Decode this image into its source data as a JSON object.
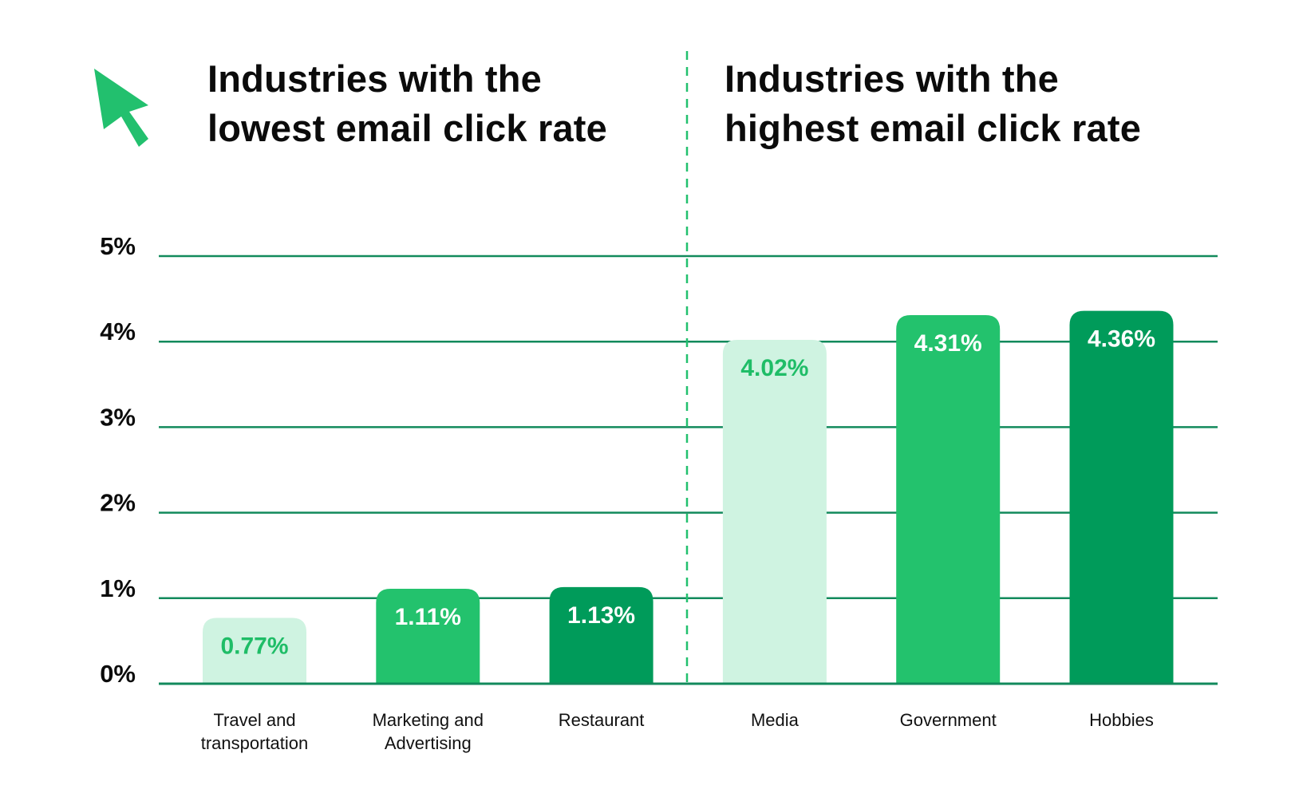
{
  "titles": {
    "left": [
      "Industries with the",
      "lowest email click rate"
    ],
    "right": [
      "Industries with the",
      "highest email click rate"
    ]
  },
  "icons": {
    "cursor": "cursor-arrow-icon"
  },
  "colors": {
    "grid": "#128a5c",
    "divider": "#22c06e",
    "light": "#cff3e1",
    "mid": "#23c26d",
    "dark": "#009b5a",
    "light_label": "#1fbd67",
    "white_label": "#ffffff",
    "cursor": "#22c06e"
  },
  "chart_data": {
    "type": "bar",
    "title": "Industries with the lowest / highest email click rate",
    "xlabel": "",
    "ylabel": "",
    "ylim": [
      0,
      5
    ],
    "yticks": [
      0,
      1,
      2,
      3,
      4,
      5
    ],
    "ytick_labels": [
      "0%",
      "1%",
      "2%",
      "3%",
      "4%",
      "5%"
    ],
    "grid": true,
    "groups": [
      {
        "name": "Industries with the lowest email click rate",
        "categories": [
          0,
          1,
          2
        ]
      },
      {
        "name": "Industries with the highest email click rate",
        "categories": [
          3,
          4,
          5
        ]
      }
    ],
    "categories": [
      "Travel and transportation",
      "Marketing and Advertising",
      "Restaurant",
      "Media",
      "Government",
      "Hobbies"
    ],
    "category_lines": [
      [
        "Travel and",
        "transportation"
      ],
      [
        "Marketing and",
        "Advertising"
      ],
      [
        "Restaurant"
      ],
      [
        "Media"
      ],
      [
        "Government"
      ],
      [
        "Hobbies"
      ]
    ],
    "values": [
      0.77,
      1.11,
      1.13,
      4.02,
      4.31,
      4.36
    ],
    "value_labels": [
      "0.77%",
      "1.11%",
      "1.13%",
      "4.02%",
      "4.31%",
      "4.36%"
    ],
    "bar_shades": [
      "light",
      "mid",
      "dark",
      "light",
      "mid",
      "dark"
    ]
  }
}
